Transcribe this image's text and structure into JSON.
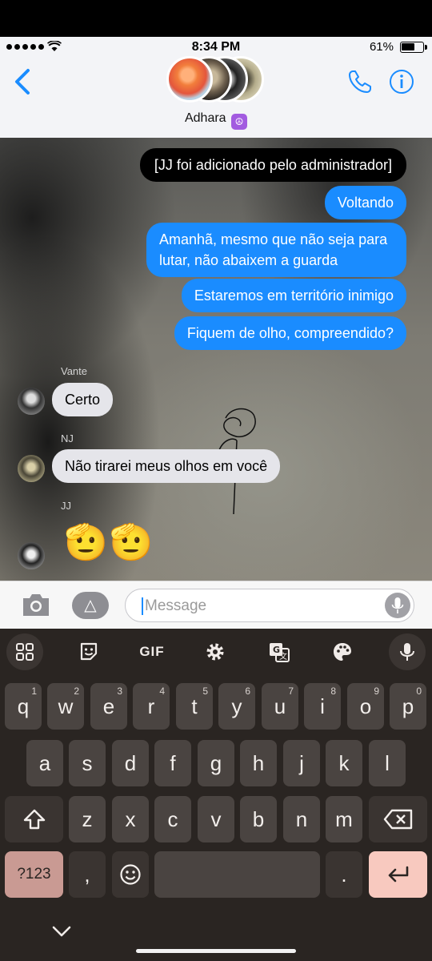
{
  "status": {
    "time": "8:34 PM",
    "battery": "61%",
    "battery_level": 0.61
  },
  "header": {
    "group_name": "Adhara",
    "group_emoji": "☮"
  },
  "messages": {
    "system": "[JJ foi adicionado pelo administrador]",
    "out1": "Voltando",
    "out2": "Amanhã, mesmo que não seja para lutar, não abaixem a guarda",
    "out3": "Estaremos em território inimigo",
    "out4": "Fiquem de olho, compreendido?",
    "sender1": "Vante",
    "in1": "Certo",
    "sender2": "NJ",
    "in2": "Não tirarei meus olhos em você",
    "sender3": "JJ",
    "in3": "🫡🫡"
  },
  "input": {
    "placeholder": "Message"
  },
  "keyboard": {
    "toolbar": [
      "apps-grid-icon",
      "sticker-icon",
      "GIF",
      "settings-icon",
      "translate-icon",
      "palette-icon",
      "mic-icon"
    ],
    "gif_label": "GIF",
    "row1": [
      "q",
      "w",
      "e",
      "r",
      "t",
      "y",
      "u",
      "i",
      "o",
      "p"
    ],
    "row1_hints": [
      "1",
      "2",
      "3",
      "4",
      "5",
      "6",
      "7",
      "8",
      "9",
      "0"
    ],
    "row2": [
      "a",
      "s",
      "d",
      "f",
      "g",
      "h",
      "j",
      "k",
      "l"
    ],
    "row3": [
      "z",
      "x",
      "c",
      "v",
      "b",
      "n",
      "m"
    ],
    "symbols": "?123",
    "comma": ",",
    "period": ".",
    "accent_pink": "#f8c9bf"
  }
}
